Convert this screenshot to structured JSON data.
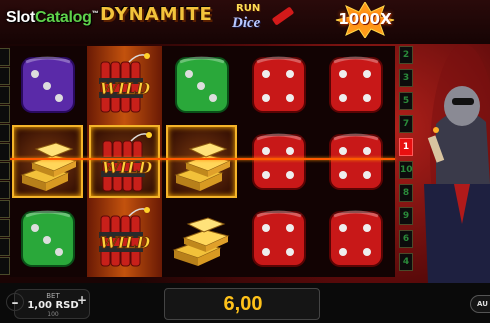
{
  "brand": {
    "part1": "Slot",
    "part2": "Catalog",
    "tm": "™"
  },
  "logo": {
    "main": "DYNAMITE",
    "sub1": "RUN",
    "sub2": "Dice"
  },
  "multiplier": {
    "label": "1000X"
  },
  "reels": [
    [
      "dice-purple",
      "gold-bars",
      "dice-green"
    ],
    [
      "wild",
      "wild",
      "wild"
    ],
    [
      "dice-green",
      "gold-bars",
      "gold-bars"
    ],
    [
      "dice-red",
      "dice-red",
      "dice-red"
    ],
    [
      "dice-red",
      "dice-red",
      "dice-red"
    ]
  ],
  "wild_label": "WILD",
  "paylines_left": [
    "",
    "",
    "",
    "",
    "",
    "",
    "",
    "",
    "",
    "",
    "",
    ""
  ],
  "paylines_right": [
    "2",
    "3",
    "5",
    "7",
    "1",
    "10",
    "8",
    "9",
    "6",
    "4"
  ],
  "active_payline": "1",
  "bottom": {
    "minus": "–",
    "bet_label": "BET",
    "bet_value": "1,00 RSD",
    "bet_sub": "100",
    "plus": "+",
    "win_value": "6,00",
    "auto_label": "AU"
  },
  "colors": {
    "gold": "#ffc21a",
    "accent": "#e81010",
    "wild_bg": "#c3520d"
  }
}
